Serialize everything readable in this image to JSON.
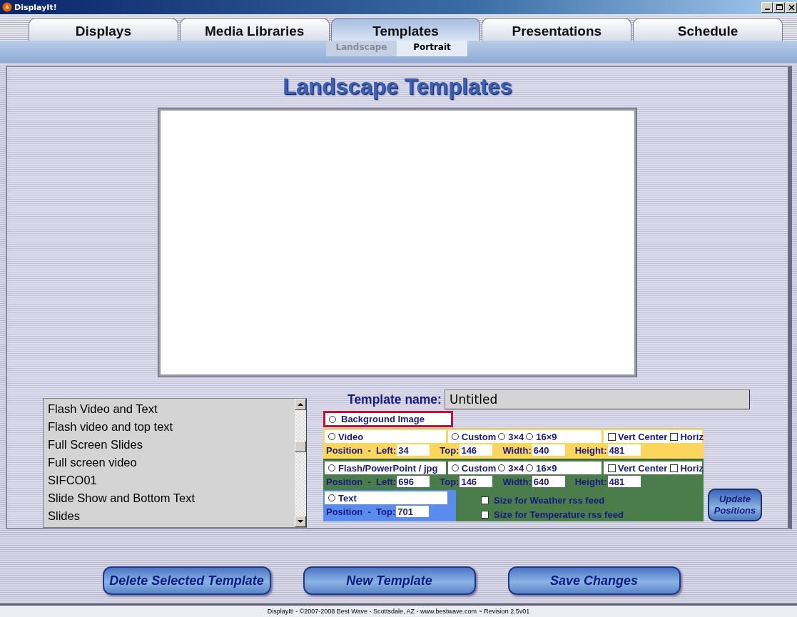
{
  "window": {
    "title": "DisplayIt!"
  },
  "tabs": [
    {
      "label": "Displays",
      "selected": false
    },
    {
      "label": "Media Libraries",
      "selected": false
    },
    {
      "label": "Templates",
      "selected": true
    },
    {
      "label": "Presentations",
      "selected": false
    },
    {
      "label": "Schedule",
      "selected": false
    }
  ],
  "subtabs": [
    {
      "label": "Landscape",
      "selected": true
    },
    {
      "label": "Portrait",
      "selected": false
    }
  ],
  "heading": "Landscape Templates",
  "template_list": [
    {
      "label": "Flash Video and Text",
      "selected": false
    },
    {
      "label": "Flash video and top text",
      "selected": false
    },
    {
      "label": "Full Screen Slides",
      "selected": false
    },
    {
      "label": "Full screen video",
      "selected": false
    },
    {
      "label": "SIFCO01",
      "selected": false
    },
    {
      "label": "Slide Show and Bottom Text",
      "selected": false
    },
    {
      "label": "Slides",
      "selected": false
    }
  ],
  "template_name": {
    "label": "Template name:",
    "value": "Untitled"
  },
  "background_image": {
    "label": "Background Image",
    "selected": false
  },
  "media_blocks": [
    {
      "kind": "video",
      "color": "#fcd65c",
      "label": "Video",
      "selected": false,
      "aspects": [
        {
          "label": "Custom",
          "selected": false
        },
        {
          "label": "3×4",
          "selected": false
        },
        {
          "label": "16×9",
          "selected": false
        }
      ],
      "checks": [
        {
          "label": "Vert Center",
          "checked": false
        },
        {
          "label": "Horiz",
          "checked": false
        }
      ],
      "position": [
        {
          "label": "Position  -  Left:",
          "value": "34"
        },
        {
          "label": "Top:",
          "value": "146"
        },
        {
          "label": "Width:",
          "value": "640"
        },
        {
          "label": "Height:",
          "value": "481"
        }
      ]
    },
    {
      "kind": "flash",
      "color": "#4a7d4a",
      "label": "Flash/PowerPoint / jpg",
      "selected": false,
      "aspects": [
        {
          "label": "Custom",
          "selected": false
        },
        {
          "label": "3×4",
          "selected": false
        },
        {
          "label": "16×9",
          "selected": false
        }
      ],
      "checks": [
        {
          "label": "Vert Center",
          "checked": false
        },
        {
          "label": "Horiz",
          "checked": false
        }
      ],
      "position": [
        {
          "label": "Position  -  Left:",
          "value": "696"
        },
        {
          "label": "Top:",
          "value": "146"
        },
        {
          "label": "Width:",
          "value": "640"
        },
        {
          "label": "Height:",
          "value": "481"
        }
      ]
    }
  ],
  "text_block": {
    "label": "Text",
    "selected": false,
    "position": {
      "label": "Position  -  Top:",
      "value": "701"
    }
  },
  "feed_options": [
    {
      "label": "Size for Weather rss feed",
      "checked": false
    },
    {
      "label": "Size for Temperature rss feed",
      "checked": false
    }
  ],
  "update_button": "Update Positions",
  "buttons": [
    "Delete Selected Template",
    "New Template",
    "Save Changes"
  ],
  "footer": "DisplayIt! - ©2007-2008 Best Wave - Scottsdale, AZ - www.bestwave.com ~ Revision 2.5v01"
}
